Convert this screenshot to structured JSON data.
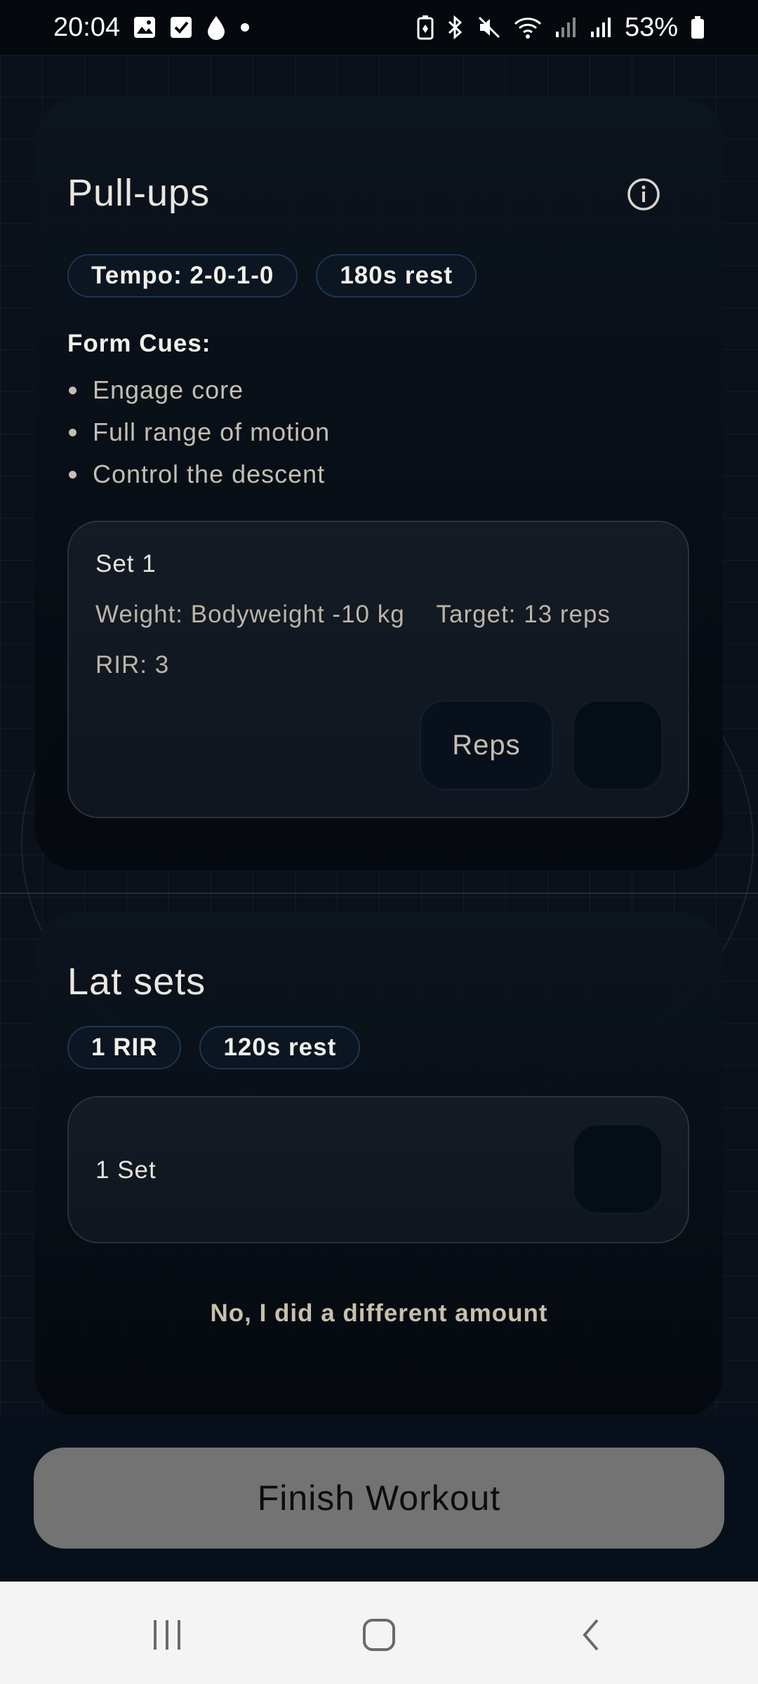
{
  "status_bar": {
    "time": "20:04",
    "battery": "53%",
    "left_icons": [
      "gallery-icon",
      "checkbox-icon",
      "drop-icon",
      "dot-icon"
    ],
    "right_icons": [
      "battery-saver-icon",
      "bluetooth-icon",
      "mute-icon",
      "wifi-icon",
      "signal-icon",
      "signal-icon",
      "battery-icon"
    ]
  },
  "exercise_1": {
    "title": "Pull-ups",
    "info_icon": "info-icon",
    "chips": [
      "Tempo: 2-0-1-0",
      "180s rest"
    ],
    "form_cues_label": "Form Cues:",
    "form_cues": [
      "Engage core",
      "Full range of motion",
      "Control the descent"
    ],
    "set": {
      "title": "Set 1",
      "weight": "Weight: Bodyweight -10 kg",
      "target": "Target: 13 reps",
      "rir": "RIR: 3",
      "reps_button": "Reps"
    }
  },
  "exercise_2": {
    "title": "Lat sets",
    "chips": [
      "1 RIR",
      "120s rest"
    ],
    "set_label": "1 Set",
    "different_amount": "No, I did a different amount"
  },
  "finish_button": "Finish Workout",
  "nav_bar": {
    "icons": [
      "recent-apps-icon",
      "home-icon",
      "back-icon"
    ]
  },
  "colors": {
    "background": "#0a111a",
    "chip_border": "#1d3553",
    "finish_button": "#737373",
    "nav_bar": "#f4f4f4"
  }
}
